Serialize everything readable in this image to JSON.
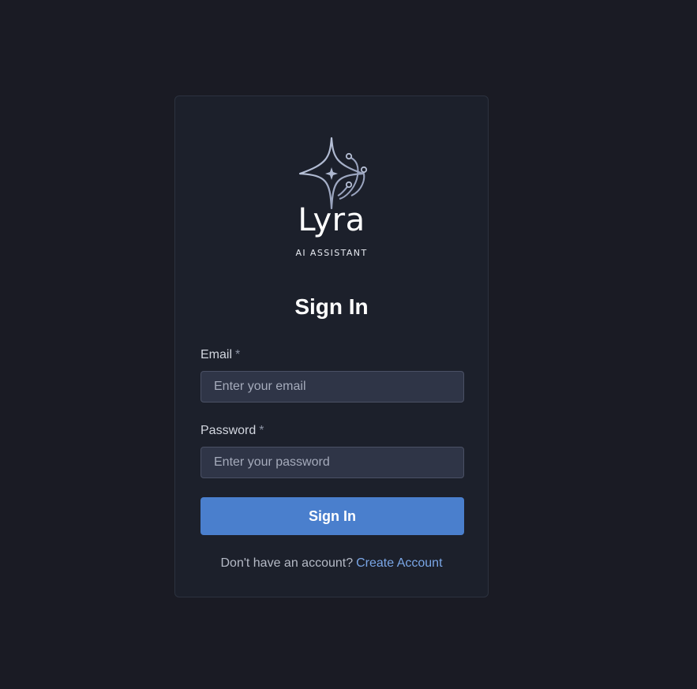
{
  "brand": {
    "name": "Lyra",
    "tagline": "AI ASSISTANT",
    "logo_icon": "sparkle-star-circuit-icon"
  },
  "form": {
    "title": "Sign In",
    "email": {
      "label": "Email",
      "required_marker": "*",
      "placeholder": "Enter your email",
      "value": ""
    },
    "password": {
      "label": "Password",
      "required_marker": "*",
      "placeholder": "Enter your password",
      "value": ""
    },
    "submit_label": "Sign In",
    "signup_prompt": "Don't have an account?",
    "signup_link": "Create Account"
  },
  "colors": {
    "background": "#1a1b24",
    "card": "#1c202b",
    "accent": "#4a7fcd",
    "link": "#7aa6e6"
  }
}
